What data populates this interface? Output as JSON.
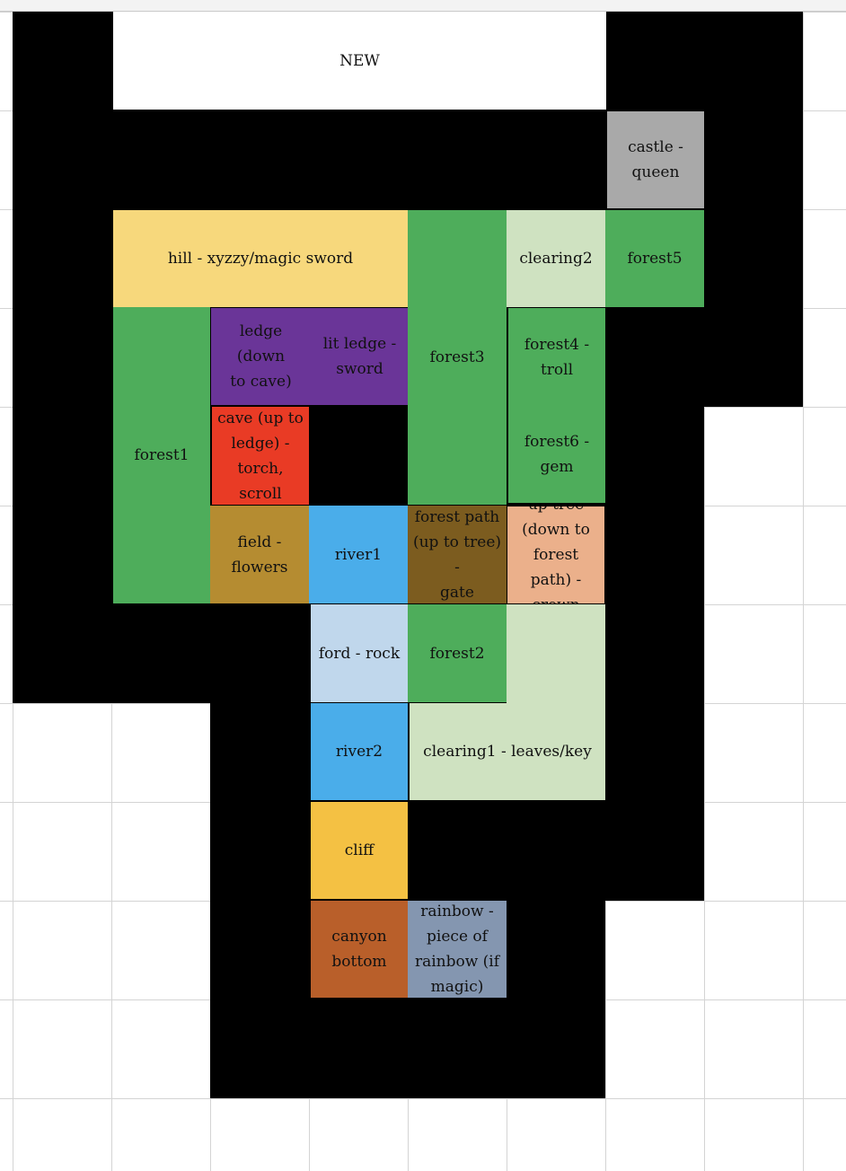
{
  "title": "NEW",
  "colors": {
    "background": "#ffffff",
    "gridline": "#d4d4d4",
    "wall": "#000000",
    "forest": "#4ead5b",
    "clearing": "#cfe2c1",
    "hill": "#f7d87c",
    "cave_ledge": "#6a3598",
    "cave": "#e93b25",
    "field": "#b58c31",
    "river": "#4aadea",
    "ford": "#c0d7ec",
    "forest_path": "#7c5c1f",
    "up_tree": "#ebb08b",
    "castle": "#a9a9a9",
    "cliff": "#f4c143",
    "canyon": "#b95f2a",
    "rainbow": "#8496b0"
  },
  "rooms": {
    "castle": "castle -\nqueen",
    "hill": "hill - xyzzy/magic sword",
    "clearing2": "clearing2",
    "forest5": "forest5",
    "forest1": "forest1",
    "ledge": "ledge (down\nto cave)",
    "lit_ledge": "lit ledge -\nsword",
    "forest3": "forest3",
    "forest4": "forest4 -\ntroll",
    "cave": "cave (up to\nledge) -\ntorch, scroll",
    "forest6": "forest6 -\ngem",
    "field": "field -\nflowers",
    "river1": "river1",
    "forest_path": "forest path\n(up to tree) -\ngate",
    "up_tree": "up tree\n(down to\nforest path) -\ncrown",
    "ford": "ford - rock",
    "forest2": "forest2",
    "river2": "river2",
    "clearing1": "clearing1 - leaves/key",
    "cliff": "cliff",
    "canyon": "canyon\nbottom",
    "rainbow": "rainbow -\npiece of\nrainbow  (if\nmagic)"
  }
}
